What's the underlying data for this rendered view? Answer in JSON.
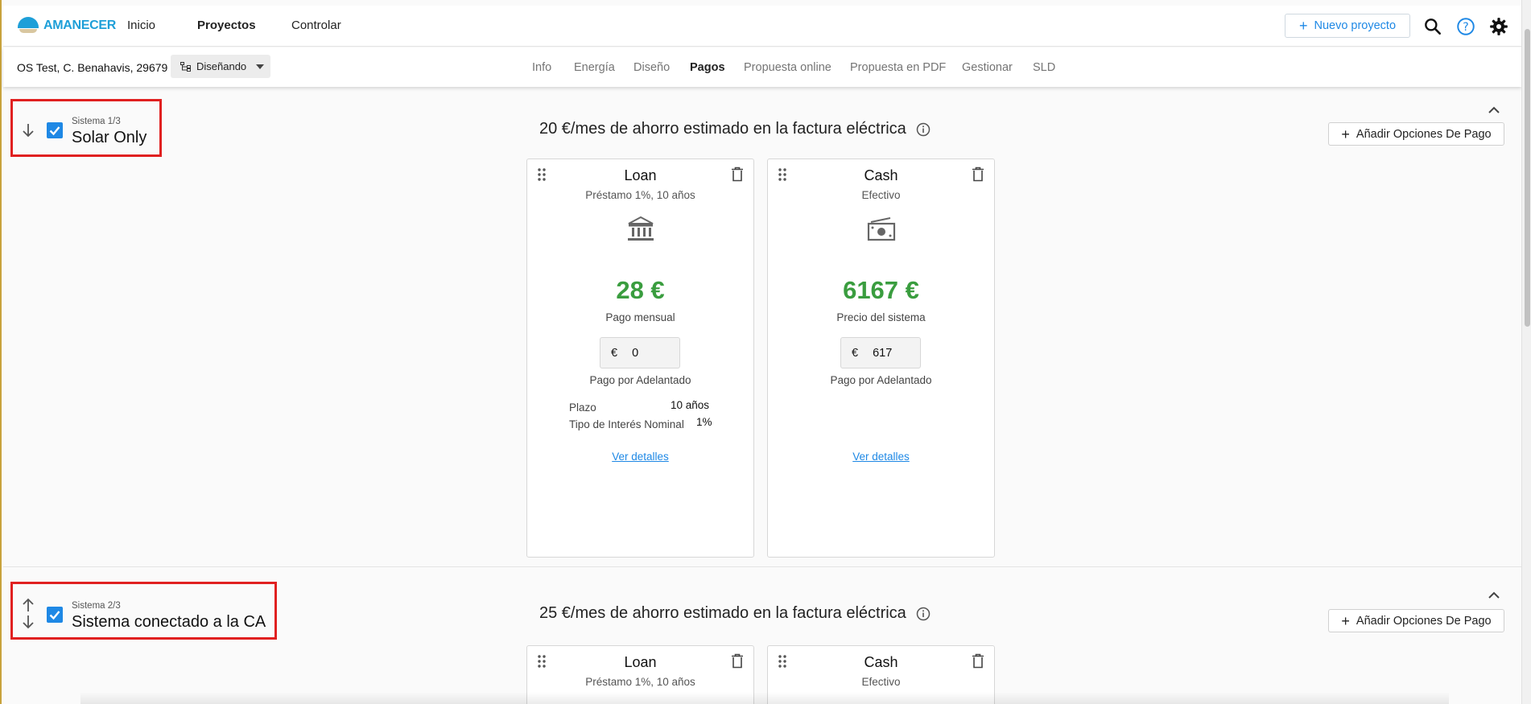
{
  "topnav": {
    "logo_text": "AMANECER",
    "links": [
      "Inicio",
      "Proyectos",
      "Controlar"
    ],
    "new_project_label": "Nuevo proyecto"
  },
  "subbar": {
    "address": "OS Test, C. Benahavis, 29679",
    "status": "Diseñando",
    "tabs": [
      "Info",
      "Energía",
      "Diseño",
      "Pagos",
      "Propuesta online",
      "Propuesta en PDF",
      "Gestionar",
      "SLD"
    ],
    "active_tab": "Pagos"
  },
  "systems": [
    {
      "index_label": "Sistema 1/3",
      "name": "Solar Only",
      "savings": "20 €/mes de ahorro estimado en la factura eléctrica",
      "add_payment_label": "Añadir Opciones De Pago",
      "cards": [
        {
          "title": "Loan",
          "subtitle": "Préstamo 1%, 10 años",
          "icon": "bank-icon",
          "amount": "28 €",
          "amount_label": "Pago mensual",
          "currency": "€",
          "down_payment": "0",
          "down_payment_label": "Pago por Adelantado",
          "details": [
            {
              "k": "Plazo",
              "v": "10 años"
            },
            {
              "k": "Tipo de Interés Nominal",
              "v": "1%"
            }
          ],
          "link": "Ver detalles"
        },
        {
          "title": "Cash",
          "subtitle": "Efectivo",
          "icon": "cash-icon",
          "amount": "6167 €",
          "amount_label": "Precio del sistema",
          "currency": "€",
          "down_payment": "617",
          "down_payment_label": "Pago por Adelantado",
          "details": [],
          "link": "Ver detalles"
        }
      ]
    },
    {
      "index_label": "Sistema 2/3",
      "name": "Sistema conectado a la CA",
      "savings": "25 €/mes de ahorro estimado en la factura eléctrica",
      "add_payment_label": "Añadir Opciones De Pago",
      "cards": [
        {
          "title": "Loan",
          "subtitle": "Préstamo 1%, 10 años"
        },
        {
          "title": "Cash",
          "subtitle": "Efectivo"
        }
      ]
    }
  ],
  "colors": {
    "accent": "#1e88e5",
    "amount_green": "#3a9d3f",
    "highlight_red": "#e02020"
  }
}
